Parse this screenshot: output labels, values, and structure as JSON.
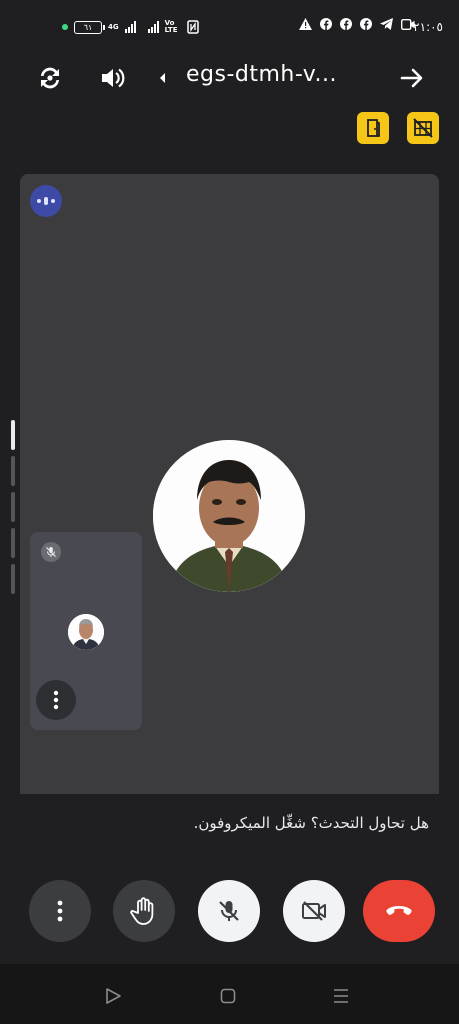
{
  "status_bar": {
    "battery": "٦١",
    "network": "4G",
    "volte": "Vo LTE",
    "time": "٢١:٠٥",
    "icons": [
      "warning-icon",
      "facebook-icon",
      "facebook-icon",
      "facebook-icon",
      "telegram-icon",
      "video-call-icon"
    ]
  },
  "top_bar": {
    "meeting_code": "egs-dtmh-v..."
  },
  "call_stage": {
    "main_participant_avatar": "participant-photo",
    "self_tile_muted": true
  },
  "hint_text": "هل تحاول التحدث؟ شغِّل الميكروفون.",
  "controls": {
    "more": "more-options",
    "raise_hand": "raise-hand",
    "microphone": "mic-off",
    "camera": "camera-off",
    "end_call": "end-call"
  },
  "colors": {
    "background": "#1f1f21",
    "stage": "#3c3c3f",
    "end_call": "#ea4335",
    "accent_yellow": "#f5c518",
    "speaking": "#3d4aa6"
  }
}
